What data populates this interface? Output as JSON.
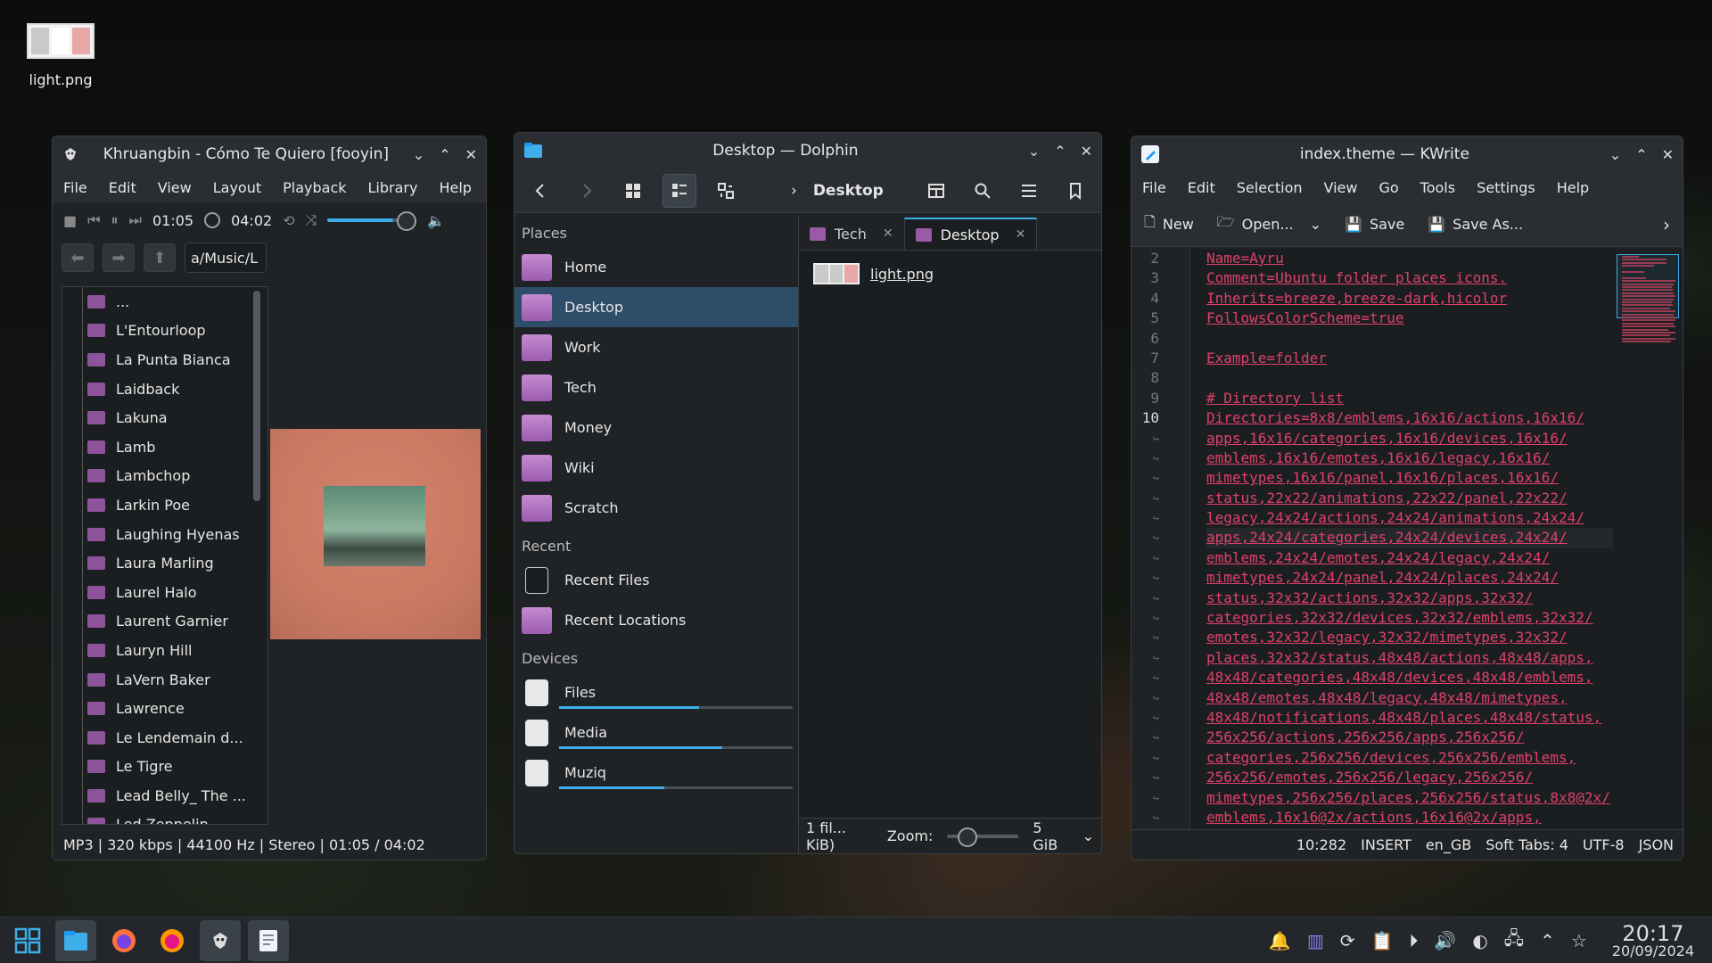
{
  "desktop": {
    "icon_label": "light.png"
  },
  "fooyin": {
    "title": "Khruangbin - Cómo Te Quiero [fooyin]",
    "menu": [
      "File",
      "Edit",
      "View",
      "Layout",
      "Playback",
      "Library",
      "Help"
    ],
    "elapsed": "01:05",
    "total": "04:02",
    "volume_level": 0.8,
    "path": "a/Music/L",
    "tree": [
      "...",
      "L'Entourloop",
      "La Punta Bianca",
      "Laidback",
      "Lakuna",
      "Lamb",
      "Lambchop",
      "Larkin Poe",
      "Laughing Hyenas",
      "Laura Marling",
      "Laurel Halo",
      "Laurent Garnier",
      "Lauryn Hill",
      "LaVern Baker",
      "Lawrence",
      "Le Lendemain d...",
      "Le Tigre",
      "Lead Belly_ The ...",
      "Led Zeppelin"
    ],
    "status": "MP3 | 320 kbps | 44100 Hz | Stereo | 01:05 / 04:02"
  },
  "dolphin": {
    "title": "Desktop — Dolphin",
    "crumb": "Desktop",
    "places_header": "Places",
    "places": [
      "Home",
      "Desktop",
      "Work",
      "Tech",
      "Money",
      "Wiki",
      "Scratch"
    ],
    "recent_header": "Recent",
    "recent": [
      "Recent Files",
      "Recent Locations"
    ],
    "devices_header": "Devices",
    "devices": [
      {
        "label": "Files",
        "usage": 0.6
      },
      {
        "label": "Media",
        "usage": 0.7
      },
      {
        "label": "Muziq",
        "usage": 0.45
      }
    ],
    "tabs": [
      "Tech",
      "Desktop"
    ],
    "file": "light.png",
    "status_files": "1 fil... KiB)",
    "zoom_label": "Zoom:",
    "free_space": "5 GiB"
  },
  "kwrite": {
    "title": "index.theme — KWrite",
    "menu": [
      "File",
      "Edit",
      "Selection",
      "View",
      "Go",
      "Tools",
      "Settings",
      "Help"
    ],
    "toolbar": {
      "new": "New",
      "open": "Open...",
      "save": "Save",
      "save_as": "Save As..."
    },
    "line_numbers": [
      "2",
      "3",
      "4",
      "5",
      "6",
      "7",
      "8",
      "9",
      "10",
      "↪",
      "↪",
      "↪",
      "↪",
      "↪",
      "↪",
      "↪",
      "↪",
      "↪",
      "↪",
      "↪",
      "↪",
      "↪",
      "↪",
      "↪",
      "↪",
      "↪",
      "↪",
      "↪",
      "↪",
      "↪"
    ],
    "lines": [
      "Name=Ayru",
      "Comment=Ubuntu folder places icons.",
      "Inherits=breeze,breeze-dark,hicolor",
      "FollowsColorScheme=true",
      "",
      "Example=folder",
      "",
      "# Directory list",
      "Directories=8x8/emblems,16x16/actions,16x16/",
      "apps,16x16/categories,16x16/devices,16x16/",
      "emblems,16x16/emotes,16x16/legacy,16x16/",
      "mimetypes,16x16/panel,16x16/places,16x16/",
      "status,22x22/animations,22x22/panel,22x22/",
      "legacy,24x24/actions,24x24/animations,24x24/",
      "apps,24x24/categories,24x24/devices,24x24/",
      "emblems,24x24/emotes,24x24/legacy,24x24/",
      "mimetypes,24x24/panel,24x24/places,24x24/",
      "status,32x32/actions,32x32/apps,32x32/",
      "categories,32x32/devices,32x32/emblems,32x32/",
      "emotes,32x32/legacy,32x32/mimetypes,32x32/",
      "places,32x32/status,48x48/actions,48x48/apps,",
      "48x48/categories,48x48/devices,48x48/emblems,",
      "48x48/emotes,48x48/legacy,48x48/mimetypes,",
      "48x48/notifications,48x48/places,48x48/status,",
      "256x256/actions,256x256/apps,256x256/",
      "categories,256x256/devices,256x256/emblems,",
      "256x256/emotes,256x256/legacy,256x256/",
      "mimetypes,256x256/places,256x256/status,8x8@2x/",
      "emblems,16x16@2x/actions,16x16@2x/apps,"
    ],
    "status": [
      "10:282",
      "INSERT",
      "en_GB",
      "Soft Tabs: 4",
      "UTF-8",
      "JSON"
    ]
  },
  "taskbar": {
    "time": "20:17",
    "date": "20/09/2024"
  },
  "colors": {
    "accent": "#3daee9",
    "code": "#e0406a",
    "folder": "#9b5aa8"
  }
}
